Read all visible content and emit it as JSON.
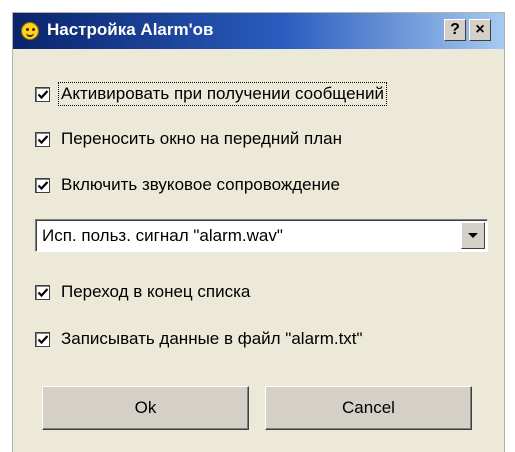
{
  "window": {
    "title": "Настройка Alarm'ов",
    "help_label": "?",
    "close_label": "×"
  },
  "options": [
    {
      "label": "Активировать при получении сообщений",
      "checked": true
    },
    {
      "label": "Переносить окно на передний план",
      "checked": true
    },
    {
      "label": "Включить звуковое сопровождение",
      "checked": true
    },
    {
      "label": "Переход в конец списка",
      "checked": true
    },
    {
      "label": "Записывать данные в файл \"alarm.txt\"",
      "checked": true
    }
  ],
  "sound_select": {
    "value": "Исп. польз. сигнал \"alarm.wav\""
  },
  "buttons": {
    "ok": "Ok",
    "cancel": "Cancel"
  },
  "colors": {
    "titlebar_start": "#0a246a",
    "titlebar_end": "#a6caf0",
    "dialog_face": "#ece9d8"
  },
  "icons": {
    "title": "smiley-icon",
    "check": "checkmark-icon",
    "dropdown": "dropdown-arrow-icon"
  }
}
